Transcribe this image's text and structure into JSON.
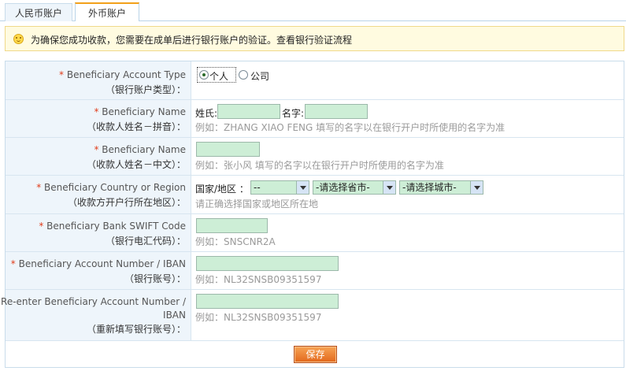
{
  "tabs": [
    {
      "label": "人民币账户",
      "active": false
    },
    {
      "label": "外币账户",
      "active": true
    }
  ],
  "notice": {
    "message": "为确保您成功收款，您需要在成单后进行银行账户的验证。",
    "link": "查看银行验证流程"
  },
  "fields": {
    "account_type": {
      "label_en": "Beneficiary Account Type",
      "label_cn": "（银行账户类型）：",
      "options": [
        "个人",
        "公司"
      ],
      "selected": "个人"
    },
    "name_pinyin": {
      "label_en": "Beneficiary Name",
      "label_cn": "（收款人姓名－拼音）：",
      "surname_label": "姓氏:",
      "given_label": "名字:",
      "surname_value": "",
      "given_value": "",
      "hint": "例如：ZHANG XIAO FENG 填写的名字以在银行开户时所使用的名字为准"
    },
    "name_chinese": {
      "label_en": "Beneficiary Name",
      "label_cn": "（收款人姓名－中文）：",
      "value": "",
      "hint": "例如：张小风 填写的名字以在银行开户时所使用的名字为准"
    },
    "country": {
      "label_en": "Beneficiary Country or Region",
      "label_cn": "（收款方开户行所在地区）：",
      "country_label": "国家/地区 ：",
      "country_value": "--",
      "province_value": "-请选择省市-",
      "city_value": "-请选择城市-",
      "hint": "请正确选择国家或地区所在地"
    },
    "swift": {
      "label_en": "Beneficiary Bank SWIFT Code",
      "label_cn": "（银行电汇代码）：",
      "value": "",
      "hint": "例如：SNSCNR2A"
    },
    "account_number": {
      "label_en": "Beneficiary Account Number / IBAN",
      "label_cn": "（银行账号）：",
      "value": "",
      "hint": "例如：NL32SNSB09351597"
    },
    "reenter_account": {
      "label_en_1": "Re-enter Beneficiary Account Number /",
      "label_en_2": "IBAN",
      "label_cn": "（重新填写银行账号）：",
      "value": "",
      "hint": "例如：NL32SNSB09351597"
    }
  },
  "required_mark": "* ",
  "save_label": "保存"
}
